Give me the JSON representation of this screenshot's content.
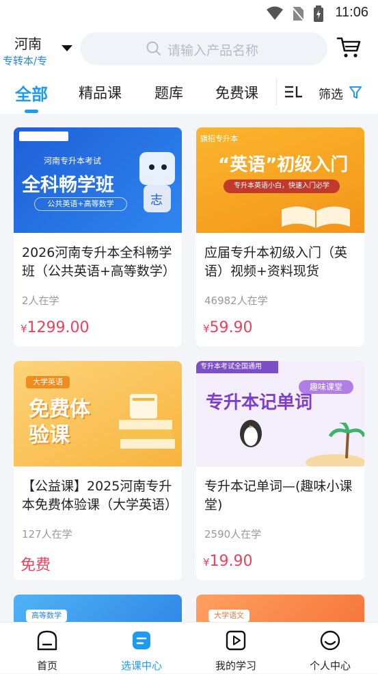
{
  "status": {
    "time": "11:06"
  },
  "header": {
    "province": "河南",
    "exam_type": "专转本/专",
    "search_placeholder": "请输入产品名称"
  },
  "tabs": [
    {
      "label": "全部",
      "active": true
    },
    {
      "label": "精品课",
      "active": false
    },
    {
      "label": "题库",
      "active": false
    },
    {
      "label": "免费课",
      "active": false
    }
  ],
  "filter_label": "筛选",
  "courses": [
    {
      "thumb_texts": [
        "河南专升本考试",
        "全科畅学班",
        "公共英语+高等数学"
      ],
      "title": "2026河南专升本全科畅学班（公共英语+高等数学）",
      "learners": "2人在学",
      "currency": "¥",
      "price": "1299.00"
    },
    {
      "thumb_texts": [
        "旗招专升本",
        "“英语”初级入门",
        "专升本英语小白，快速入门必学"
      ],
      "title": "应届专升本初级入门（英语）视频+资料现货",
      "learners": "46982人在学",
      "currency": "¥",
      "price": "59.90"
    },
    {
      "thumb_texts": [
        "大学英语",
        "免费体验课"
      ],
      "title": "【公益课】2025河南专升本免费体验课（大学英语）",
      "learners": "127人在学",
      "currency": "",
      "price": "免费"
    },
    {
      "thumb_texts": [
        "专升本考试全国通用",
        "专升本记单词",
        "趣味课堂"
      ],
      "title": "专升本记单词—(趣味小课堂)",
      "learners": "2590人在学",
      "currency": "¥",
      "price": "19.90"
    },
    {
      "thumb_texts": [
        "高等数学"
      ]
    },
    {
      "thumb_texts": [
        "大学语文"
      ]
    }
  ],
  "bottom_nav": [
    {
      "label": "首页",
      "active": false
    },
    {
      "label": "选课中心",
      "active": true
    },
    {
      "label": "我的学习",
      "active": false
    },
    {
      "label": "个人中心",
      "active": false
    }
  ],
  "colors": {
    "accent": "#1e9bf0",
    "price": "#f0405a"
  }
}
